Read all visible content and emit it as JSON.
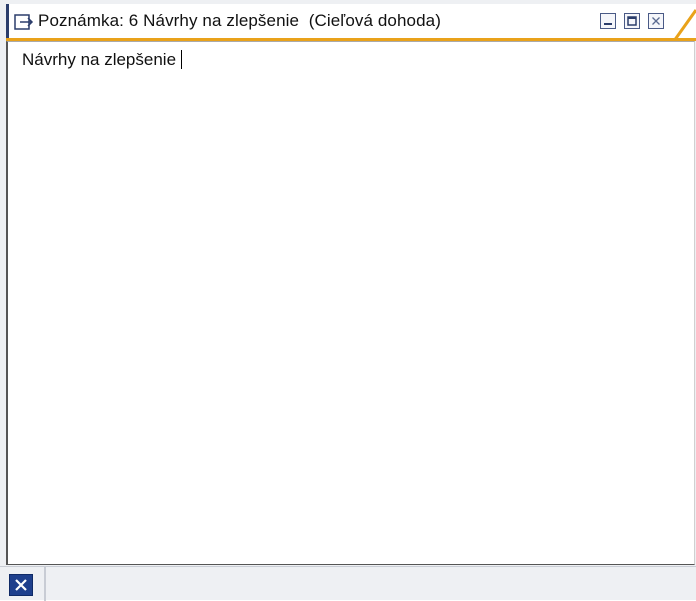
{
  "window": {
    "title": "Poznámka: 6 Návrhy na zlepšenie  (Cieľová dohoda)",
    "title_icon": "note-edit-icon",
    "controls": {
      "minimize_icon": "minimize-icon",
      "maximize_icon": "maximize-icon",
      "close_icon": "close-icon"
    }
  },
  "editor": {
    "content": "Návrhy na zlepšenie"
  },
  "statusbar": {
    "close_icon": "close-icon"
  },
  "colors": {
    "accent": "#e9a21a",
    "frame": "#2b3d6b",
    "status_button": "#1e3f8c",
    "background": "#eef0f3"
  }
}
